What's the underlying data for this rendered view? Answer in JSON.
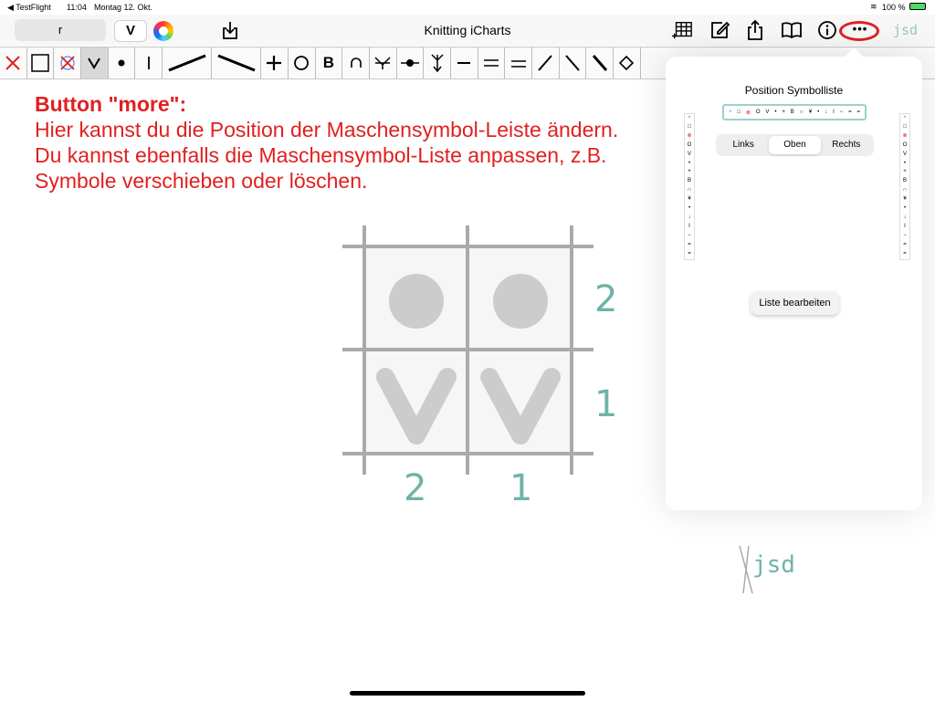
{
  "status_bar": {
    "back_app": "◀ TestFlight",
    "time": "11:04",
    "date": "Montag 12. Okt.",
    "battery": "100 %"
  },
  "nav": {
    "field_value": "r",
    "stitch_value": "V",
    "title": "Knitting iCharts",
    "more_label": "•••"
  },
  "logo_text": "jsd",
  "toolbar": {
    "symbols": [
      "✕",
      "□",
      "⊗",
      "V",
      "•",
      "I",
      "／",
      "＼",
      "+",
      "O",
      "B",
      "∩",
      "¥",
      "-•-",
      "↓",
      "−",
      "=",
      "=",
      "/",
      "\\",
      "\\",
      "◇"
    ]
  },
  "instructions": {
    "heading": "Button \"more\":",
    "line1": "Hier kannst du die Position der Maschensymbol-Leiste ändern.",
    "line2": "Du kannst ebenfalls die Maschensymbol-Liste anpassen, z.B. Symbole verschieben oder löschen."
  },
  "popover": {
    "title": "Position Symbolliste",
    "segments": [
      "Links",
      "Oben",
      "Rechts"
    ],
    "selected_segment": "Oben",
    "edit_button": "Liste bearbeiten",
    "mini_symbols": [
      "×",
      "□",
      "⊗",
      "O",
      "V",
      "•",
      "+",
      "B",
      "∩",
      "¥",
      "•",
      "↓",
      "I",
      "−",
      "=",
      "="
    ]
  },
  "chart": {
    "row_labels": [
      "2",
      "1"
    ],
    "col_labels": [
      "2",
      "1"
    ],
    "row2_stitch": "purl-dot",
    "row1_stitch": "knit-v"
  },
  "colors": {
    "accent_red": "#e02020",
    "teal": "#6fb3a8",
    "grid_grey": "#aaaaaa"
  }
}
